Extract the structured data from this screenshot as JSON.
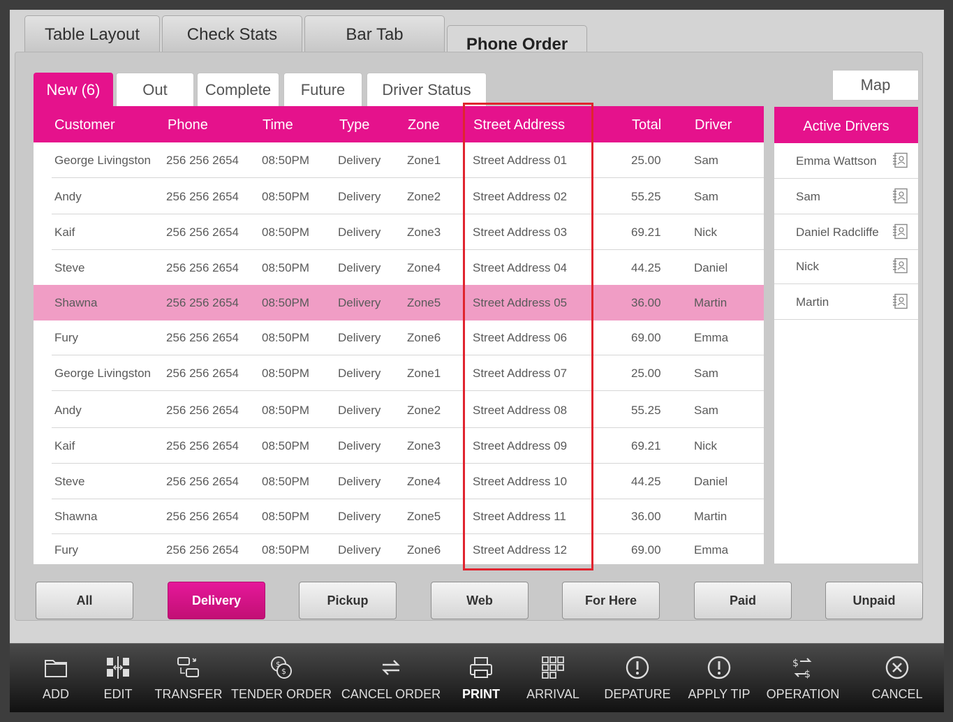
{
  "top_tabs": [
    {
      "label": "Table Layout"
    },
    {
      "label": "Check Stats"
    },
    {
      "label": "Bar Tab"
    },
    {
      "label": "Phone Order",
      "active": true
    }
  ],
  "sub_tabs": [
    {
      "label": "New (6)",
      "active": true
    },
    {
      "label": "Out"
    },
    {
      "label": "Complete"
    },
    {
      "label": "Future"
    },
    {
      "label": "Driver Status"
    }
  ],
  "map_label": "Map",
  "orders": {
    "columns": [
      "Customer",
      "Phone",
      "Time",
      "Type",
      "Zone",
      "Street Address",
      "Total",
      "Driver"
    ],
    "rows": [
      [
        "George Livingston",
        "256 256 2654",
        "08:50PM",
        "Delivery",
        "Zone1",
        "Street Address 01",
        "25.00",
        "Sam"
      ],
      [
        "Andy",
        "256 256 2654",
        "08:50PM",
        "Delivery",
        "Zone2",
        "Street Address 02",
        "55.25",
        "Sam"
      ],
      [
        "Kaif",
        "256 256 2654",
        "08:50PM",
        "Delivery",
        "Zone3",
        "Street Address 03",
        "69.21",
        "Nick"
      ],
      [
        "Steve",
        "256 256 2654",
        "08:50PM",
        "Delivery",
        "Zone4",
        "Street Address 04",
        "44.25",
        "Daniel"
      ],
      [
        "Shawna",
        "256 256 2654",
        "08:50PM",
        "Delivery",
        "Zone5",
        "Street Address 05",
        "36.00",
        "Martin"
      ],
      [
        "Fury",
        "256 256 2654",
        "08:50PM",
        "Delivery",
        "Zone6",
        "Street Address 06",
        "69.00",
        "Emma"
      ],
      [
        "George Livingston",
        "256 256 2654",
        "08:50PM",
        "Delivery",
        "Zone1",
        "Street Address 07",
        "25.00",
        "Sam"
      ],
      [
        "Andy",
        "256 256 2654",
        "08:50PM",
        "Delivery",
        "Zone2",
        "Street Address 08",
        "55.25",
        "Sam"
      ],
      [
        "Kaif",
        "256 256 2654",
        "08:50PM",
        "Delivery",
        "Zone3",
        "Street Address 09",
        "69.21",
        "Nick"
      ],
      [
        "Steve",
        "256 256 2654",
        "08:50PM",
        "Delivery",
        "Zone4",
        "Street Address 10",
        "44.25",
        "Daniel"
      ],
      [
        "Shawna",
        "256 256 2654",
        "08:50PM",
        "Delivery",
        "Zone5",
        "Street Address 11",
        "36.00",
        "Martin"
      ],
      [
        "Fury",
        "256 256 2654",
        "08:50PM",
        "Delivery",
        "Zone6",
        "Street Address 12",
        "69.00",
        "Emma"
      ]
    ],
    "selected_row": 4
  },
  "drivers": {
    "title": "Active Drivers",
    "items": [
      {
        "name": "Emma Wattson",
        "icon": "contact-card-icon"
      },
      {
        "name": "Sam",
        "icon": "contact-card-icon"
      },
      {
        "name": "Daniel Radcliffe",
        "icon": "contact-card-icon"
      },
      {
        "name": "Nick",
        "icon": "contact-card-icon"
      },
      {
        "name": "Martin",
        "icon": "contact-card-icon"
      }
    ]
  },
  "filters": [
    {
      "label": "All"
    },
    {
      "label": "Delivery",
      "active": true
    },
    {
      "label": "Pickup"
    },
    {
      "label": "Web"
    },
    {
      "label": "For Here"
    },
    {
      "label": "Paid"
    },
    {
      "label": "Unpaid"
    }
  ],
  "toolbar": [
    {
      "label": "ADD",
      "icon": "folder-icon"
    },
    {
      "label": "EDIT",
      "icon": "edit-icon"
    },
    {
      "label": "TRANSFER",
      "icon": "transfer-icon"
    },
    {
      "label": "TENDER ORDER",
      "icon": "coins-icon"
    },
    {
      "label": "CANCEL ORDER",
      "icon": "swap-arrows-icon"
    },
    {
      "label": "PRINT",
      "icon": "printer-icon",
      "bold": true
    },
    {
      "label": "ARRIVAL",
      "icon": "grid-icon"
    },
    {
      "label": "DEPATURE",
      "icon": "alert-circle-icon"
    },
    {
      "label": "APPLY TIP",
      "icon": "alert-circle-icon"
    },
    {
      "label": "OPERATION",
      "icon": "currency-exchange-icon"
    },
    {
      "label": "CANCEL",
      "icon": "close-circle-icon"
    }
  ],
  "colors": {
    "accent": "#e5128c",
    "selected_row": "#f09dc5",
    "highlight_box": "#e0242f"
  }
}
